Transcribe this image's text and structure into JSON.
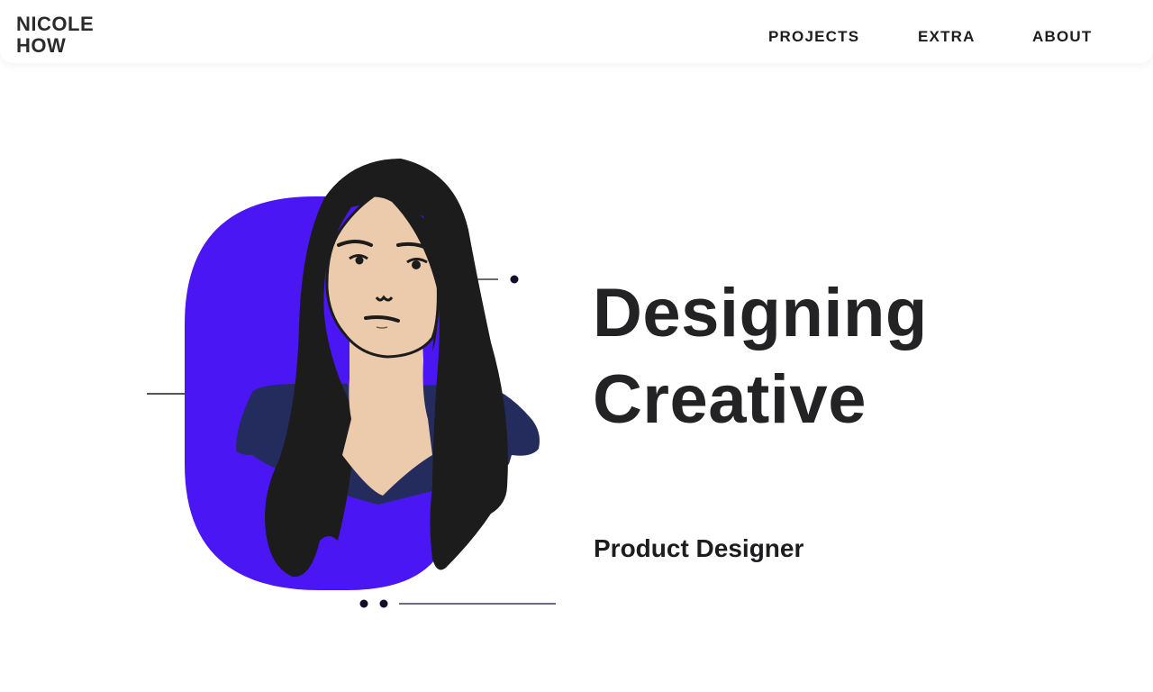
{
  "brand": {
    "name_line1": "NICOLE",
    "name_line2": "HOW"
  },
  "nav": {
    "items": [
      {
        "label": "PROJECTS"
      },
      {
        "label": "EXTRA"
      },
      {
        "label": "ABOUT"
      }
    ]
  },
  "hero": {
    "headline_line1": "Designing",
    "headline_line2": "Creative",
    "subtitle": "Product Designer",
    "portrait_icon": "portrait-illustration-icon"
  },
  "colors": {
    "accent": "#4a16f4",
    "shirt": "#232c5c",
    "skin": "#ebcbac",
    "hair": "#1c1c1c",
    "text": "#1d1d1f"
  }
}
